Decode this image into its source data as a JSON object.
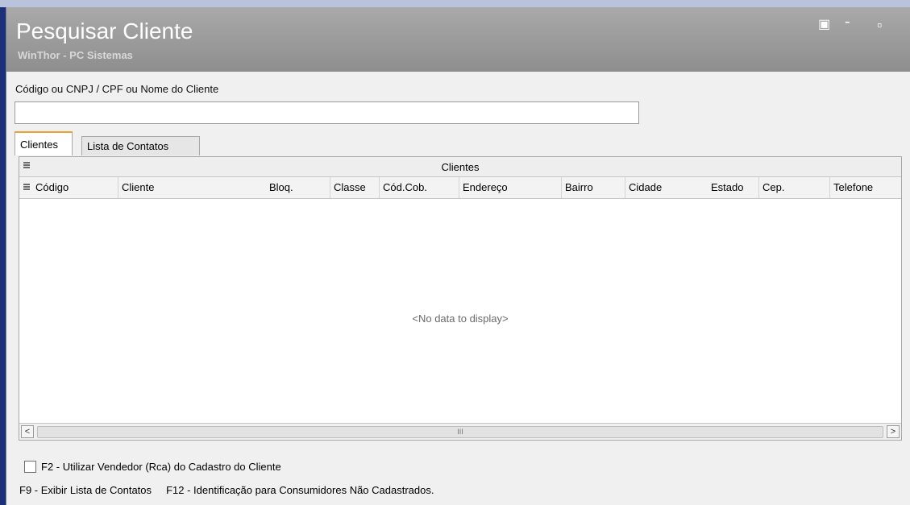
{
  "window": {
    "title": "Pesquisar Cliente",
    "subtitle": "WinThor - PC Sistemas",
    "controls": {
      "restore_icon": "▣",
      "minimize_icon": "-",
      "maximize_icon": "▫"
    }
  },
  "search": {
    "label": "Código ou CNPJ / CPF  ou Nome  do Cliente",
    "value": ""
  },
  "tabs": [
    {
      "label": "Clientes",
      "active": true
    },
    {
      "label": "Lista de Contatos",
      "active": false
    }
  ],
  "grid": {
    "band_label": "Clientes",
    "columns": [
      "Código",
      "Cliente",
      "Bloq.",
      "Classe",
      "Cód.Cob.",
      "Endereço",
      "Bairro",
      "Cidade",
      "Estado",
      "Cep.",
      "Telefone"
    ],
    "rows": [],
    "empty_text": "<No data to display>",
    "scroll": {
      "left": "<",
      "right": ">",
      "grip": "III"
    }
  },
  "options": {
    "use_rca_label": "F2 - Utilizar Vendedor (Rca) do Cadastro do Cliente",
    "use_rca_checked": false
  },
  "footer": {
    "text": "F9 - Exibir Lista de Contatos     F12 - Identificação para Consumidores Não Cadastrados."
  },
  "colors": {
    "background": "#1d2f78",
    "titlebar": "#9a9a9a",
    "active_tab_accent": "#f0a030"
  }
}
